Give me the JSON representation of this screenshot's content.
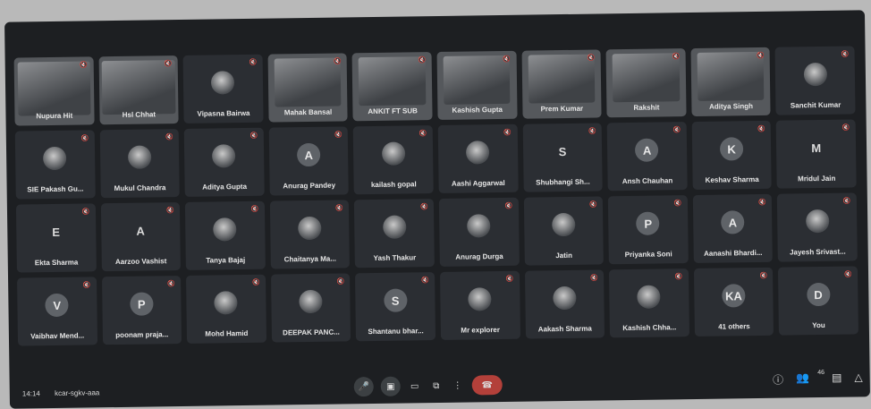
{
  "participants": [
    {
      "name": "Nupura Hit",
      "kind": "video"
    },
    {
      "name": "Hsl Chhat",
      "kind": "video"
    },
    {
      "name": "Vipasna Bairwa",
      "kind": "img"
    },
    {
      "name": "Mahak Bansal",
      "kind": "video"
    },
    {
      "name": "ANKIT FT SUB",
      "kind": "video"
    },
    {
      "name": "Kashish Gupta",
      "kind": "video"
    },
    {
      "name": "Prem Kumar",
      "kind": "video"
    },
    {
      "name": "Rakshit",
      "kind": "video"
    },
    {
      "name": "Aditya Singh",
      "kind": "video"
    },
    {
      "name": "Sanchit Kumar",
      "kind": "img"
    },
    {
      "name": "SIE Pakash Gu...",
      "kind": "img"
    },
    {
      "name": "Mukul Chandra",
      "kind": "img"
    },
    {
      "name": "Aditya Gupta",
      "kind": "img"
    },
    {
      "name": "Anurag Pandey",
      "kind": "letter",
      "letter": "A"
    },
    {
      "name": "kailash gopal",
      "kind": "img"
    },
    {
      "name": "Aashi Aggarwal",
      "kind": "img"
    },
    {
      "name": "Shubhangi Sh...",
      "kind": "plain",
      "letter": "S"
    },
    {
      "name": "Ansh Chauhan",
      "kind": "letter",
      "letter": "A"
    },
    {
      "name": "Keshav Sharma",
      "kind": "letter",
      "letter": "K"
    },
    {
      "name": "Mridul Jain",
      "kind": "plain",
      "letter": "M"
    },
    {
      "name": "Ekta Sharma",
      "kind": "plain",
      "letter": "E"
    },
    {
      "name": "Aarzoo Vashist",
      "kind": "plain",
      "letter": "A"
    },
    {
      "name": "Tanya Bajaj",
      "kind": "img"
    },
    {
      "name": "Chaitanya Ma...",
      "kind": "img"
    },
    {
      "name": "Yash Thakur",
      "kind": "img"
    },
    {
      "name": "Anurag Durga",
      "kind": "img"
    },
    {
      "name": "Jatin",
      "kind": "img"
    },
    {
      "name": "Priyanka Soni",
      "kind": "letter",
      "letter": "P"
    },
    {
      "name": "Aanashi Bhardi...",
      "kind": "letter",
      "letter": "A"
    },
    {
      "name": "Jayesh Srivast...",
      "kind": "img"
    },
    {
      "name": "Vaibhav Mend...",
      "kind": "letter",
      "letter": "V"
    },
    {
      "name": "poonam praja...",
      "kind": "letter",
      "letter": "P"
    },
    {
      "name": "Mohd Hamid",
      "kind": "img"
    },
    {
      "name": "DEEPAK PANC...",
      "kind": "img"
    },
    {
      "name": "Shantanu bhar...",
      "kind": "letter",
      "letter": "S"
    },
    {
      "name": "Mr explorer",
      "kind": "img"
    },
    {
      "name": "Aakash Sharma",
      "kind": "img"
    },
    {
      "name": "Kashish Chha...",
      "kind": "img"
    },
    {
      "name": "41 others",
      "kind": "letter",
      "letter": "KA"
    },
    {
      "name": "You",
      "kind": "letter",
      "letter": "D"
    }
  ],
  "meeting": {
    "time": "14:14",
    "code": "kcar-sgkv-aaa"
  },
  "controls": {
    "mic_icon": "mic-icon",
    "camera_icon": "camera-icon",
    "captions_icon": "captions-icon",
    "present_icon": "present-icon",
    "more_icon": "more-icon",
    "end_call_icon": "end-call-icon"
  },
  "right_controls": {
    "people_count": "46"
  },
  "colors": {
    "background": "#1d1f22",
    "tile": "#2b2e33",
    "end_call": "#b3403a"
  }
}
